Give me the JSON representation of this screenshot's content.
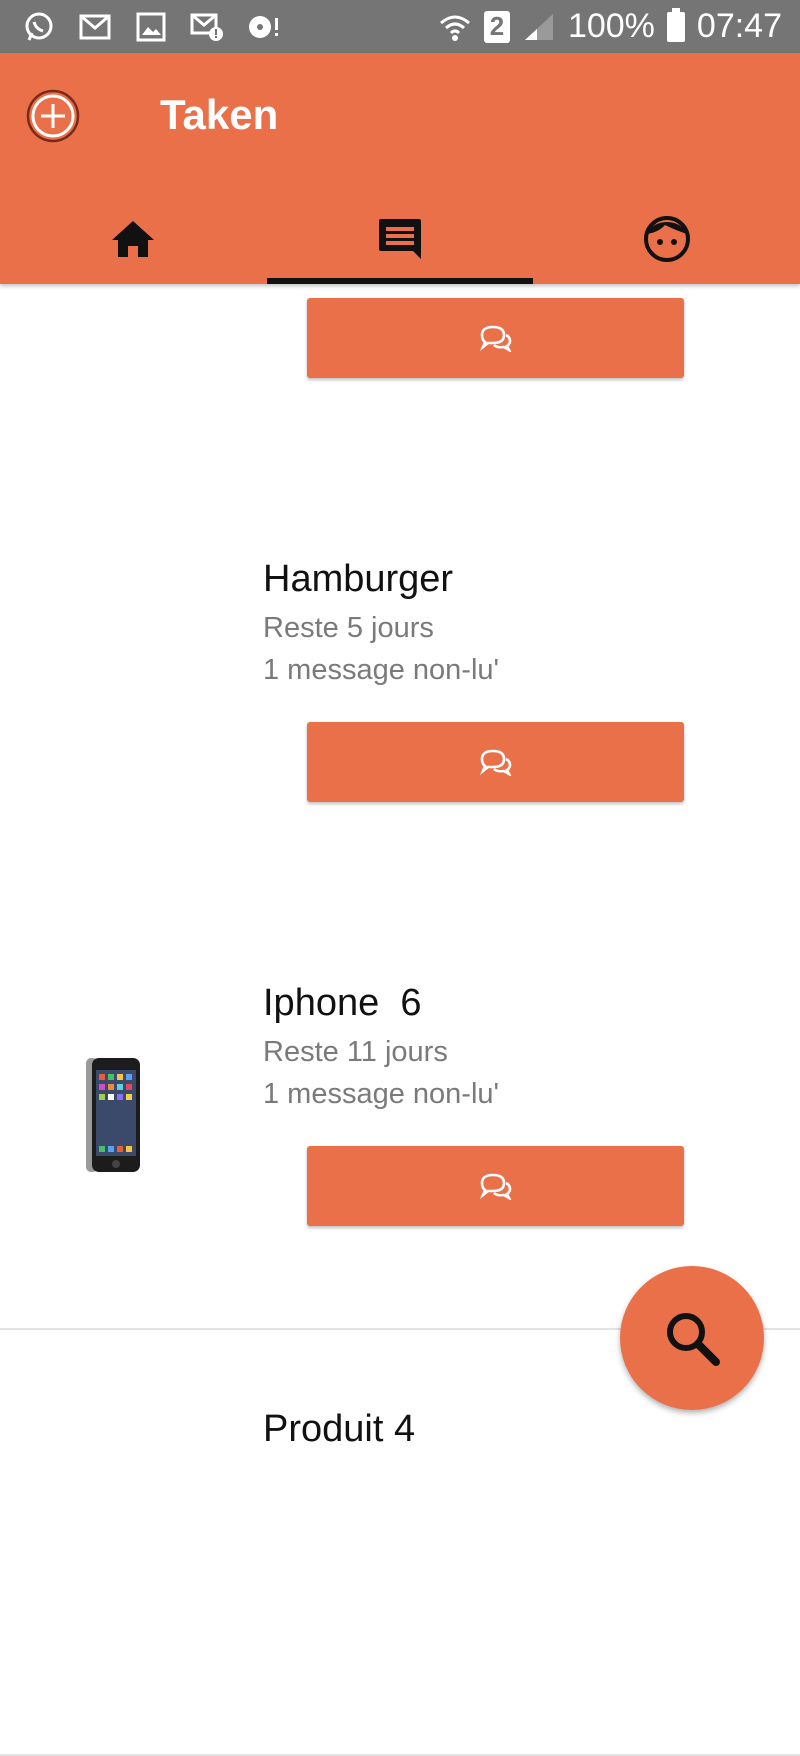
{
  "status_bar": {
    "battery": "100%",
    "time": "07:47",
    "sim": "2"
  },
  "app_bar": {
    "title": "Taken",
    "tabs": [
      {
        "icon": "home-icon",
        "active": false
      },
      {
        "icon": "chat-icon",
        "active": true
      },
      {
        "icon": "profile-icon",
        "active": false
      }
    ]
  },
  "items": [
    {
      "title": "",
      "remaining": "",
      "unread": "",
      "has_image": false
    },
    {
      "title": "Hamburger",
      "remaining": "Reste 5 jours",
      "unread": "1 message non-lu'",
      "has_image": false
    },
    {
      "title": "Iphone  6",
      "remaining": "Reste 11 jours",
      "unread": "1 message non-lu'",
      "has_image": true
    },
    {
      "title": "Produit 4",
      "remaining": "",
      "unread": "",
      "has_image": false
    }
  ],
  "colors": {
    "accent": "#E97049",
    "status_bar": "#757575",
    "tab_indicator": "#111111"
  }
}
